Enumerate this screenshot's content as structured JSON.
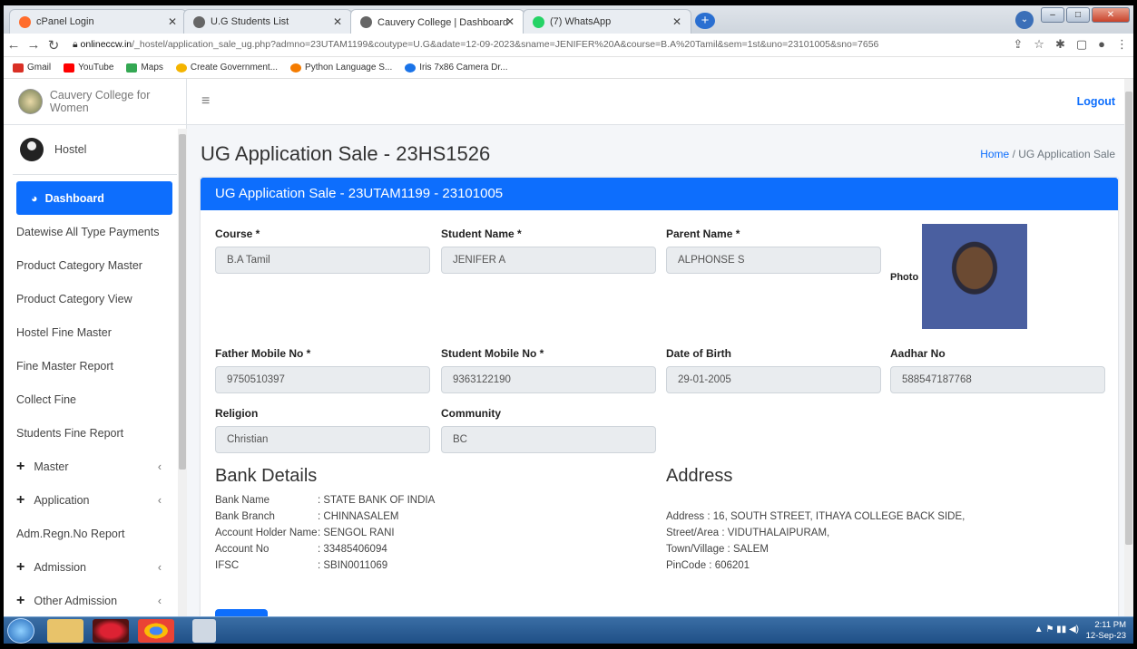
{
  "browser": {
    "tabs": [
      {
        "title": "cPanel Login",
        "color": "#ff6c2c"
      },
      {
        "title": "U.G Students List",
        "color": "#555"
      },
      {
        "title": "Cauvery College | Dashboard",
        "color": "#555"
      },
      {
        "title": "(7) WhatsApp",
        "color": "#25d366"
      }
    ],
    "new_tab": "+",
    "url_host": "onlineccw.in",
    "url_rest": "/_hostel/application_sale_ug.php?admno=23UTAM1199&coutype=U.G&adate=12-09-2023&sname=JENIFER%20A&course=B.A%20Tamil&sem=1st&uno=23101005&sno=7656",
    "bookmarks": [
      {
        "label": "Gmail",
        "color": "#d93025"
      },
      {
        "label": "YouTube",
        "color": "#ff0000"
      },
      {
        "label": "Maps",
        "color": "#34a853"
      },
      {
        "label": "Create Government...",
        "color": "#f4b400"
      },
      {
        "label": "Python Language S...",
        "color": "#f57c00"
      },
      {
        "label": "Iris 7x86 Camera Dr...",
        "color": "#1a73e8"
      }
    ]
  },
  "sidebar": {
    "brand": "Cauvery College for Women",
    "user": "Hostel",
    "items": [
      {
        "label": "Dashboard",
        "active": true
      },
      {
        "label": "Datewise All Type Payments"
      },
      {
        "label": "Product Category Master"
      },
      {
        "label": "Product Category View"
      },
      {
        "label": "Hostel Fine Master"
      },
      {
        "label": "Fine Master Report"
      },
      {
        "label": "Collect Fine"
      },
      {
        "label": "Students Fine Report"
      },
      {
        "label": "Master",
        "plus": "+",
        "chev": "‹"
      },
      {
        "label": "Application",
        "plus": "+",
        "chev": "‹"
      },
      {
        "label": "Adm.Regn.No Report"
      },
      {
        "label": "Admission",
        "plus": "+",
        "chev": "‹"
      },
      {
        "label": "Other Admission",
        "plus": "+",
        "chev": "‹"
      }
    ]
  },
  "topnav": {
    "logout": "Logout",
    "menu_icon": "≡"
  },
  "page": {
    "title": "UG Application Sale - 23HS1526",
    "crumb_home": "Home",
    "crumb_sep": "/",
    "crumb_current": "UG Application Sale",
    "card_title": "UG Application Sale - 23UTAM1199 - 23101005",
    "fields": {
      "course": {
        "label": "Course *",
        "value": "B.A Tamil"
      },
      "student_name": {
        "label": "Student Name *",
        "value": "JENIFER A"
      },
      "parent_name": {
        "label": "Parent Name *",
        "value": "ALPHONSE S"
      },
      "photo": {
        "label": "Photo"
      },
      "father_mobile": {
        "label": "Father Mobile No *",
        "value": "9750510397"
      },
      "student_mobile": {
        "label": "Student Mobile No *",
        "value": "9363122190"
      },
      "dob": {
        "label": "Date of Birth",
        "value": "29-01-2005"
      },
      "aadhar": {
        "label": "Aadhar No",
        "value": "588547187768"
      },
      "religion": {
        "label": "Religion",
        "value": "Christian"
      },
      "community": {
        "label": "Community",
        "value": "BC"
      }
    },
    "bank": {
      "heading": "Bank Details",
      "rows": [
        {
          "k": "Bank Name",
          "v": ": STATE BANK OF INDIA"
        },
        {
          "k": "Bank Branch",
          "v": ": CHINNASALEM"
        },
        {
          "k": "Account Holder Name",
          "v": ": SENGOL RANI"
        },
        {
          "k": "Account No",
          "v": ": 33485406094"
        },
        {
          "k": "IFSC",
          "v": ": SBIN0011069"
        }
      ]
    },
    "address": {
      "heading": "Address",
      "lines": [
        "Address : 16, SOUTH STREET, ITHAYA COLLEGE BACK SIDE,",
        "Street/Area : VIDUTHALAIPURAM,",
        "Town/Village : SALEM",
        "PinCode : 606201"
      ]
    }
  },
  "taskbar": {
    "time": "2:11 PM",
    "date": "12-Sep-23"
  }
}
